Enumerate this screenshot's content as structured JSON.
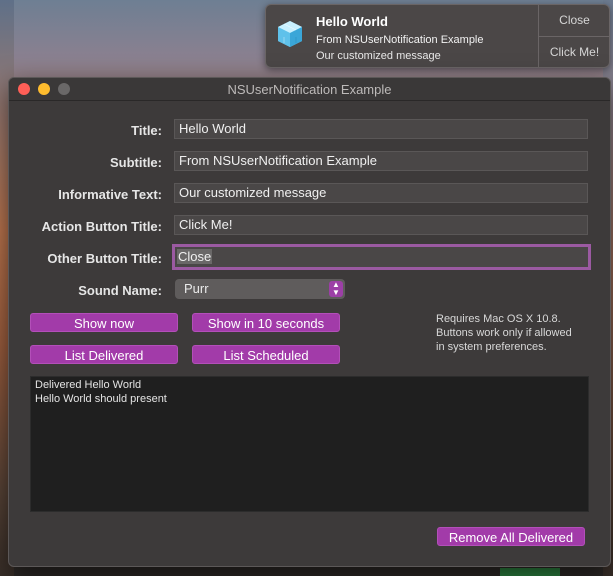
{
  "notification": {
    "title": "Hello World",
    "subtitle": "From NSUserNotification Example",
    "informative_text": "Our customized message",
    "close_label": "Close",
    "action_label": "Click Me!",
    "icon": "app-cube-icon"
  },
  "window": {
    "title": "NSUserNotification Example"
  },
  "form": {
    "title_label": "Title:",
    "title_value": "Hello World",
    "subtitle_label": "Subtitle:",
    "subtitle_value": "From NSUserNotification Example",
    "informative_label": "Informative Text:",
    "informative_value": "Our customized message",
    "action_button_label": "Action Button Title:",
    "action_button_value": "Click Me!",
    "other_button_label": "Other Button Title:",
    "other_button_value": "Close",
    "sound_label": "Sound Name:",
    "sound_value": "Purr"
  },
  "buttons": {
    "show_now": "Show now",
    "show_in_10": "Show in 10 seconds",
    "list_delivered": "List Delivered",
    "list_scheduled": "List Scheduled",
    "remove_all": "Remove All Delivered"
  },
  "note": {
    "line1": "Requires Mac OS X 10.8.",
    "line2": "Buttons work only if allowed",
    "line3": "in system preferences."
  },
  "log": {
    "lines": [
      "Delivered Hello World",
      "Hello World should present"
    ]
  },
  "colors": {
    "accent": "#a23ba9",
    "focus_ring": "#9b5aa2",
    "window_bg": "#3d3a3a"
  }
}
